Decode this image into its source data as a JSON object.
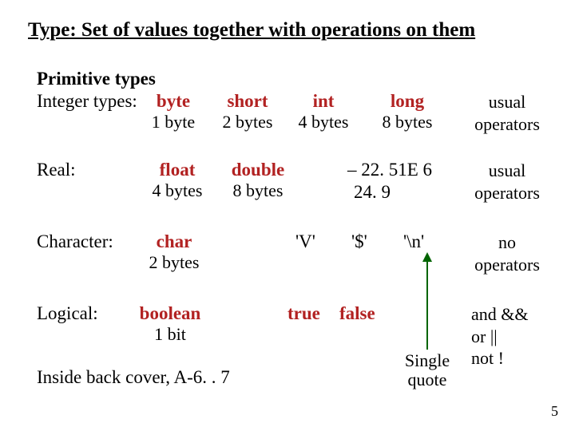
{
  "title": "Type: Set of values together with operations on them",
  "primitive_heading": "Primitive types",
  "integer": {
    "label": "Integer types:",
    "cols": [
      {
        "name": "byte",
        "size": "1 byte"
      },
      {
        "name": "short",
        "size": "2 bytes"
      },
      {
        "name": "int",
        "size": "4 bytes"
      },
      {
        "name": "long",
        "size": "8 bytes"
      }
    ],
    "ops_l1": "usual",
    "ops_l2": "operators"
  },
  "real": {
    "label": "Real:",
    "cols": [
      {
        "name": "float",
        "size": "4 bytes"
      },
      {
        "name": "double",
        "size": "8 bytes"
      }
    ],
    "ex1": "– 22. 51E 6",
    "ex2": "24. 9",
    "ops_l1": "usual",
    "ops_l2": "operators"
  },
  "character": {
    "label": "Character:",
    "name": "char",
    "size": "2 bytes",
    "examples": [
      "'V'",
      "'$'",
      "'\\n'"
    ],
    "ops_l1": "no",
    "ops_l2": "operators"
  },
  "logical": {
    "label": "Logical:",
    "name": "boolean",
    "size": "1 bit",
    "examples": [
      "true",
      "false"
    ],
    "ops_l1": "and &&",
    "ops_l2": "or ||",
    "ops_l3": "not !"
  },
  "annotation": {
    "l1": "Single",
    "l2": "quote"
  },
  "footer": "Inside back cover, A-6. . 7",
  "page_number": "5"
}
